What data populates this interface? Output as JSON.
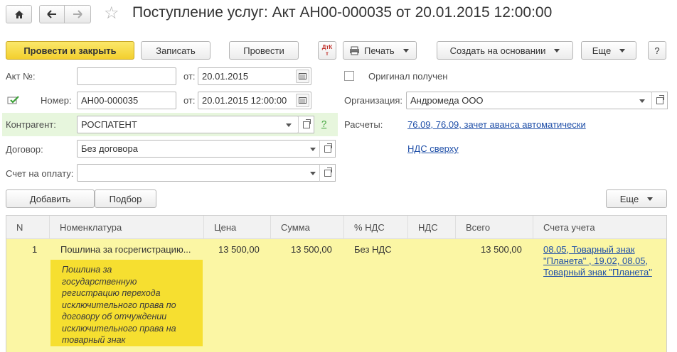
{
  "window": {
    "title": "Поступление услуг: Акт АН00-000035 от 20.01.2015 12:00:00"
  },
  "toolbar": {
    "post_close": "Провести и закрыть",
    "save": "Записать",
    "post": "Провести",
    "dtkt": "ДтКт",
    "print": "Печать",
    "create_based": "Создать на основании",
    "more": "Еще",
    "help": "?"
  },
  "form": {
    "act_label": "Акт №:",
    "act_value": "",
    "from_label": "от:",
    "act_date": "20.01.2015",
    "number_label": "Номер:",
    "number_value": "АН00-000035",
    "number_date": "20.01.2015 12:00:00",
    "original_label": "Оригинал получен",
    "org_label": "Организация:",
    "org_value": "Андромеда ООО",
    "contractor_label": "Контрагент:",
    "contractor_value": "РОСПАТЕНТ",
    "contractor_help": "?",
    "settlements_label": "Расчеты:",
    "settlements_link": "76.09, 76.09, зачет аванса автоматически",
    "contract_label": "Договор:",
    "contract_value": "Без договора",
    "vat_link": "НДС сверху",
    "invoice_label": "Счет на оплату:",
    "invoice_value": ""
  },
  "table_toolbar": {
    "add": "Добавить",
    "pick": "Подбор",
    "more": "Еще"
  },
  "table": {
    "headers": {
      "n": "N",
      "nomenclature": "Номенклатура",
      "price": "Цена",
      "sum": "Сумма",
      "vat_rate": "% НДС",
      "vat": "НДС",
      "total": "Всего",
      "accounts": "Счета учета"
    },
    "row": {
      "n": "1",
      "nomenclature": "Пошлина за госрегистрацию...",
      "price": "13 500,00",
      "sum": "13 500,00",
      "vat_rate": "Без НДС",
      "vat": "",
      "total": "13 500,00",
      "accounts_lines": [
        "08.05, Товарный знак",
        "\"Планета\" , 19.02, 08.05,",
        "Товарный знак \"Планета\""
      ]
    },
    "tooltip_lines": [
      "Пошлина за",
      "государственную",
      "регистрацию перехода",
      "исключительного права по",
      "договору об отчуждении",
      "исключительного права на",
      "товарный знак"
    ]
  }
}
